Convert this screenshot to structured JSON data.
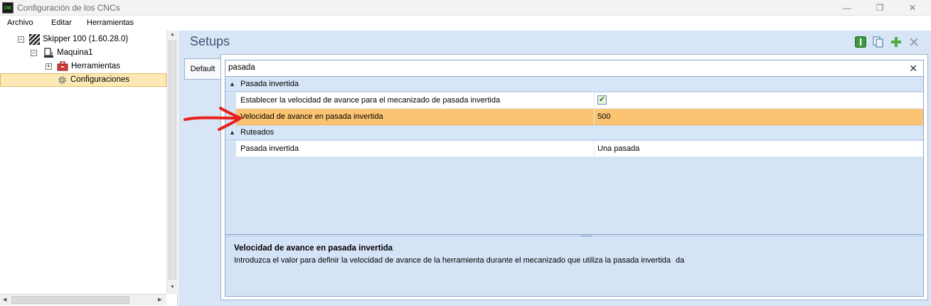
{
  "window": {
    "title": "Configuración de los CNCs",
    "app_icon_text": "CNC",
    "minimize": "—",
    "maximize": "❐",
    "close": "✕"
  },
  "menu": {
    "items": [
      "Archivo",
      "Editar",
      "Herramientas"
    ]
  },
  "tree": {
    "nodes": [
      {
        "label": "Skipper 100 (1.60.28.0)",
        "expander": "−",
        "icon": "machine-stripes-icon"
      },
      {
        "label": "Maquina1",
        "expander": "−",
        "icon": "machine-icon"
      },
      {
        "label": "Herramientas",
        "expander": "+",
        "icon": "toolbox-icon"
      },
      {
        "label": "Configuraciones",
        "icon": "gear-icon",
        "selected": true
      }
    ]
  },
  "panel": {
    "title": "Setups",
    "toolbar_icons": [
      "info-icon",
      "copy-icon",
      "add-icon",
      "delete-icon"
    ],
    "tab": "Default",
    "search": {
      "value": "pasada",
      "clear": "✕"
    },
    "categories": [
      {
        "label": "Pasada invertida",
        "rows": [
          {
            "name": "Establecer la velocidad de avance para el mecanizado de pasada invertida",
            "value": "✔",
            "type": "checkbox",
            "checked": true
          },
          {
            "name": "Velocidad de avance en pasada invertida",
            "value": "500",
            "selected": true
          }
        ]
      },
      {
        "label": "Ruteados",
        "rows": [
          {
            "name": "Pasada invertida",
            "value": "Una pasada"
          }
        ]
      }
    ],
    "description": {
      "title": "Velocidad de avance en pasada invertida",
      "text": "Introduzca el valor para definir la velocidad de avance de la herramienta durante el mecanizado que utiliza la pasada invertida",
      "overflow_text": "da"
    }
  },
  "colors": {
    "selection_row": "#fbc472",
    "annotation_arrow": "#e8211d",
    "panel_bg": "#d8e5f6"
  }
}
